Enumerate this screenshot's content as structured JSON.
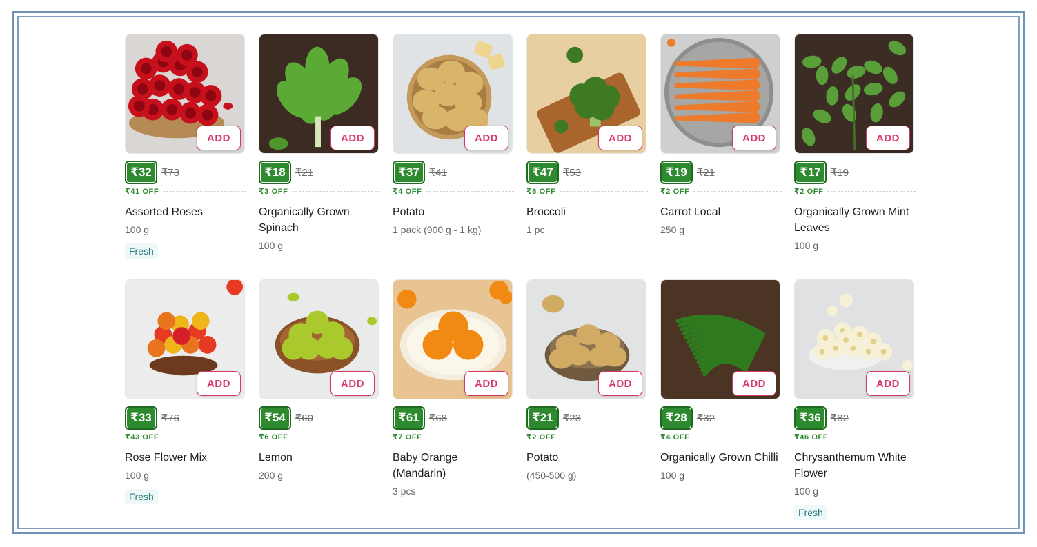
{
  "colors": {
    "accent": "#d63868",
    "price_green": "#2e8a2e",
    "frame_blue": "#6f93b6"
  },
  "add_label": "ADD",
  "products": [
    {
      "name": "Assorted Roses",
      "price": "₹32",
      "mrp": "₹73",
      "off": "₹41 OFF",
      "qty": "100 g",
      "tag": "Fresh",
      "image": "roses"
    },
    {
      "name": "Organically Grown Spinach",
      "price": "₹18",
      "mrp": "₹21",
      "off": "₹3 OFF",
      "qty": "100 g",
      "tag": "",
      "image": "spinach"
    },
    {
      "name": "Potato",
      "price": "₹37",
      "mrp": "₹41",
      "off": "₹4 OFF",
      "qty": "1 pack (900 g - 1 kg)",
      "tag": "",
      "image": "potato"
    },
    {
      "name": "Broccoli",
      "price": "₹47",
      "mrp": "₹53",
      "off": "₹6 OFF",
      "qty": "1 pc",
      "tag": "",
      "image": "broccoli"
    },
    {
      "name": "Carrot Local",
      "price": "₹19",
      "mrp": "₹21",
      "off": "₹2 OFF",
      "qty": "250 g",
      "tag": "",
      "image": "carrot"
    },
    {
      "name": "Organically Grown Mint Leaves",
      "price": "₹17",
      "mrp": "₹19",
      "off": "₹2 OFF",
      "qty": "100 g",
      "tag": "",
      "image": "mint"
    },
    {
      "name": "Rose Flower Mix",
      "price": "₹33",
      "mrp": "₹76",
      "off": "₹43 OFF",
      "qty": "100 g",
      "tag": "Fresh",
      "image": "flowermix"
    },
    {
      "name": "Lemon",
      "price": "₹54",
      "mrp": "₹60",
      "off": "₹6 OFF",
      "qty": "200 g",
      "tag": "",
      "image": "lemon"
    },
    {
      "name": "Baby Orange (Mandarin)",
      "price": "₹61",
      "mrp": "₹68",
      "off": "₹7 OFF",
      "qty": "3 pcs",
      "tag": "",
      "image": "orange"
    },
    {
      "name": "Potato",
      "price": "₹21",
      "mrp": "₹23",
      "off": "₹2 OFF",
      "qty": "(450-500 g)",
      "tag": "",
      "image": "potato2"
    },
    {
      "name": "Organically Grown Chilli",
      "price": "₹28",
      "mrp": "₹32",
      "off": "₹4 OFF",
      "qty": "100 g",
      "tag": "",
      "image": "chilli"
    },
    {
      "name": "Chrysanthemum White Flower",
      "price": "₹36",
      "mrp": "₹82",
      "off": "₹46 OFF",
      "qty": "100 g",
      "tag": "Fresh",
      "image": "chrysanthemum"
    }
  ]
}
